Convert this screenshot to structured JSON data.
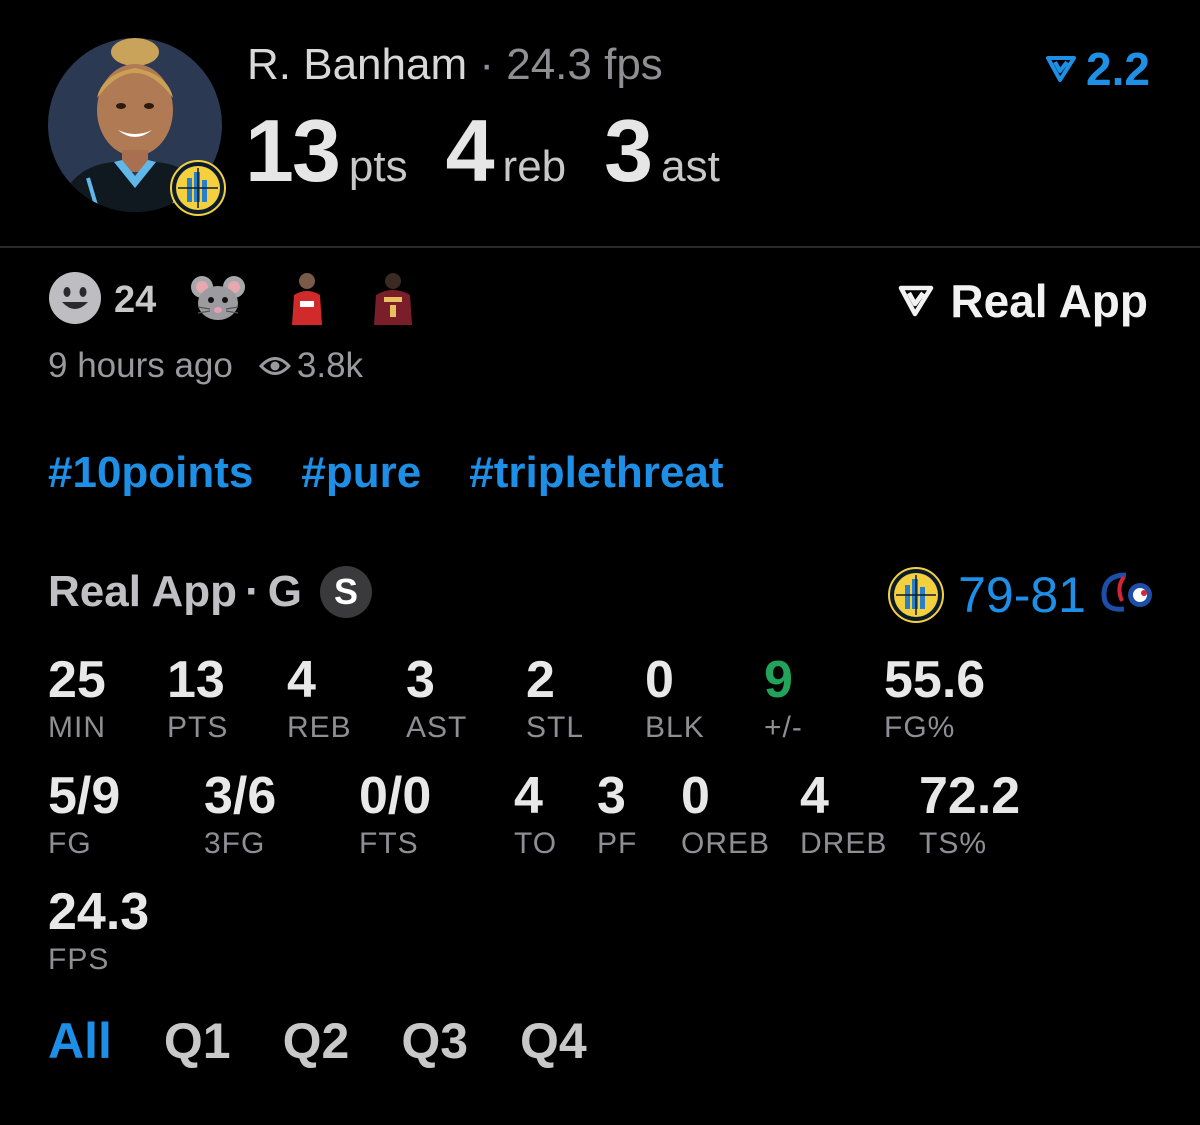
{
  "player": {
    "name": "R. Banham",
    "separator": "·",
    "fps_text": "24.3 fps",
    "pts": "13",
    "pts_unit": "pts",
    "reb": "4",
    "reb_unit": "reb",
    "ast": "3",
    "ast_unit": "ast",
    "rating": "2.2",
    "avatar_icon": "player-photo",
    "team_icon": "chicago-sky-logo"
  },
  "social": {
    "reaction_icon": "smiley-face-icon",
    "reaction_count": "24",
    "participants": [
      "mouse-emoji",
      "user-avatar-red-jersey",
      "user-avatar-maroon-jersey"
    ],
    "brand": "Real App",
    "time_ago": "9 hours ago",
    "views": "3.8k"
  },
  "tags": [
    "#10points",
    "#pure",
    "#triplethreat"
  ],
  "game": {
    "source": "Real App",
    "dot": "·",
    "position": "G",
    "badge": "S",
    "score": "79-81",
    "home_team_icon": "chicago-sky-logo",
    "away_team_icon": "washington-mystics-logo"
  },
  "stats_row1": [
    {
      "value": "25",
      "label": "MIN"
    },
    {
      "value": "13",
      "label": "PTS"
    },
    {
      "value": "4",
      "label": "REB"
    },
    {
      "value": "3",
      "label": "AST"
    },
    {
      "value": "2",
      "label": "STL"
    },
    {
      "value": "0",
      "label": "BLK"
    },
    {
      "value": "9",
      "label": "+/-"
    },
    {
      "value": "55.6",
      "label": "FG%"
    }
  ],
  "stats_row2": [
    {
      "value": "5/9",
      "label": "FG"
    },
    {
      "value": "3/6",
      "label": "3FG"
    },
    {
      "value": "0/0",
      "label": "FTS"
    },
    {
      "value": "4",
      "label": "TO"
    },
    {
      "value": "3",
      "label": "PF"
    },
    {
      "value": "0",
      "label": "OREB"
    },
    {
      "value": "4",
      "label": "DREB"
    },
    {
      "value": "72.2",
      "label": "TS%"
    }
  ],
  "stats_row3": [
    {
      "value": "24.3",
      "label": "FPS"
    }
  ],
  "periods": [
    "All",
    "Q1",
    "Q2",
    "Q3",
    "Q4"
  ],
  "active_period": "All",
  "colors": {
    "accent": "#1e8fe6",
    "positive": "#22a35a",
    "background": "#000000"
  }
}
